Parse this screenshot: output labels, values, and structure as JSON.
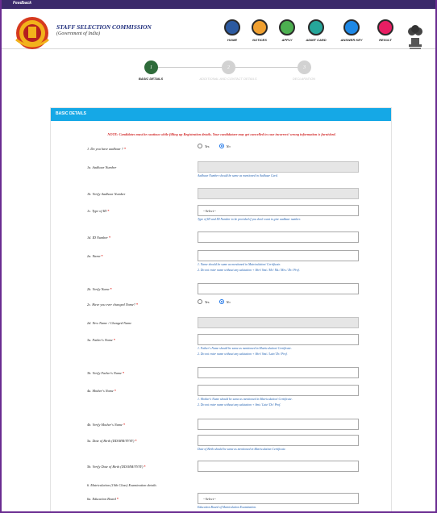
{
  "topbar": {
    "text": "Feedback"
  },
  "header": {
    "title": "STAFF SELECTION COMMISSION",
    "subtitle": "(Government of India)",
    "nav": [
      {
        "label": "HOME",
        "icon": "home-icon",
        "color": "#2c5aa0"
      },
      {
        "label": "NOTICES",
        "icon": "notices-icon",
        "color": "#f0a030"
      },
      {
        "label": "APPLY",
        "icon": "apply-icon",
        "color": "#4caf50"
      },
      {
        "label": "ADMIT CARD",
        "icon": "admit-card-icon",
        "color": "#26a69a"
      },
      {
        "label": "ANSWER KEY",
        "icon": "answer-key-icon",
        "color": "#1e88e5"
      },
      {
        "label": "RESULT",
        "icon": "result-icon",
        "color": "#e91e63"
      }
    ]
  },
  "stepper": {
    "steps": [
      {
        "number": "1",
        "label": "BASIC DETAILS",
        "active": true
      },
      {
        "number": "2",
        "label": "ADDITIONAL AND CONTACT DETAILS",
        "active": false
      },
      {
        "number": "3",
        "label": "DECLARATION",
        "active": false
      }
    ],
    "active_color": "#2e6b3a",
    "inactive_color": "#d2d2d2"
  },
  "panel": {
    "title": "BASIC DETAILS",
    "note": "NOTE: Candidates must be cautious while filling up Registration details. Your candidature may get cancelled in case incorrect/ wrong information is furnished.",
    "fields": [
      {
        "label": "1. Do you have aadhaar ?",
        "required": true,
        "type": "radio",
        "options": [
          "Yes",
          "No"
        ],
        "selected": 1
      },
      {
        "label": "1a. Aadhaar Number",
        "type": "input",
        "disabled": true,
        "hints": [
          "Aadhaar Number should be same as mentioned in Aadhaar Card."
        ]
      },
      {
        "label": "1b. Verify Aadhaar Number",
        "type": "input",
        "disabled": true
      },
      {
        "label": "1c. Type of ID",
        "required": true,
        "type": "select",
        "value": "--Select--",
        "hints": [
          "Type of ID and ID Number to be provided if you don't want to give aadhaar number."
        ]
      },
      {
        "label": "1d. ID Number",
        "required": true,
        "type": "input"
      },
      {
        "label": "2a. Name",
        "required": true,
        "type": "input",
        "hints": [
          "1. Name should be same as mentioned in Matriculation/ Certificate.",
          "2. Do not enter name without any salutation + Shri/ Smt./ Mr./ Ms./ Mrs./ Dr./ Prof."
        ]
      },
      {
        "label": "2b. Verify Name",
        "required": true,
        "type": "input"
      },
      {
        "label": "2c. Have you ever changed Name?",
        "required": true,
        "type": "radio",
        "options": [
          "Yes",
          "No"
        ],
        "selected": 1
      },
      {
        "label": "2d. New Name / Changed Name",
        "type": "input",
        "disabled": true
      },
      {
        "label": "3a. Father's Name",
        "required": true,
        "type": "input",
        "hints": [
          "1. Father's Name should be same as mentioned in Matriculation/ Certificate.",
          "2. Do not enter name without any salutation + Shri/ Smt./ Late/ Dr./ Prof."
        ]
      },
      {
        "label": "3b. Verify Father's Name",
        "required": true,
        "type": "input"
      },
      {
        "label": "4a. Mother's Name",
        "required": true,
        "type": "input",
        "hints": [
          "1. Mother's Name should be same as mentioned in Matriculation/ Certificate.",
          "2. Do not enter name without any salutation + Smt./ Late/ Dr./ Prof."
        ]
      },
      {
        "label": "4b. Verify Mother's Name",
        "required": true,
        "type": "input"
      },
      {
        "label": "5a. Date of Birth (DD/MM/YYYY)",
        "required": true,
        "type": "input",
        "hints": [
          "Date of Birth should be same as mentioned in Matriculation Certificate."
        ]
      },
      {
        "label": "5b. Verify Date of Birth (DD/MM/YYYY)",
        "required": true,
        "type": "input"
      },
      {
        "label": "6. Matriculation (10th Class) Examination details",
        "type": "section"
      },
      {
        "label": "6a. Education Board",
        "required": true,
        "type": "select",
        "value": "--Select--",
        "hints": [
          "Education Board of Matriculation Examination."
        ]
      }
    ]
  }
}
